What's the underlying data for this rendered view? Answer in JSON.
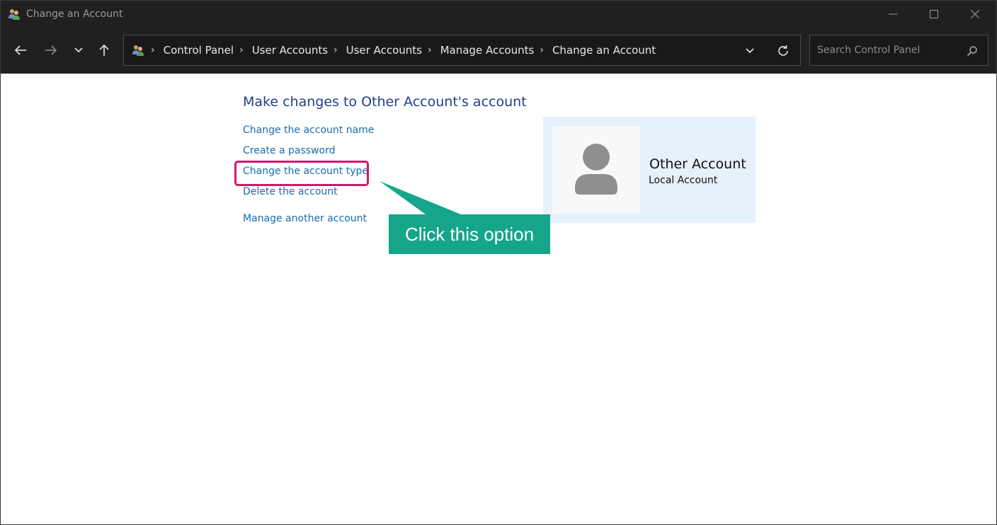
{
  "window": {
    "title": "Change an Account"
  },
  "nav": {
    "back_icon": "arrow-left-icon",
    "forward_icon": "arrow-right-icon",
    "recent_icon": "chevron-down-icon",
    "up_icon": "arrow-up-icon"
  },
  "address": {
    "crumbs": [
      "Control Panel",
      "User Accounts",
      "User Accounts",
      "Manage Accounts",
      "Change an Account"
    ]
  },
  "search": {
    "placeholder": "Search Control Panel"
  },
  "content": {
    "heading": "Make changes to Other Account's account",
    "links": {
      "change_name": "Change the account name",
      "create_password": "Create a password",
      "change_type": "Change the account type",
      "delete": "Delete the account",
      "manage_another": "Manage another account"
    }
  },
  "account": {
    "name": "Other Account",
    "type": "Local Account"
  },
  "callout": {
    "text": "Click this option"
  },
  "colors": {
    "titlebar": "#202020",
    "link": "#1a6cad",
    "heading": "#1e3f8c",
    "card": "#e5f1fb",
    "callout": "#14a58b",
    "highlight": "#d6146e"
  }
}
